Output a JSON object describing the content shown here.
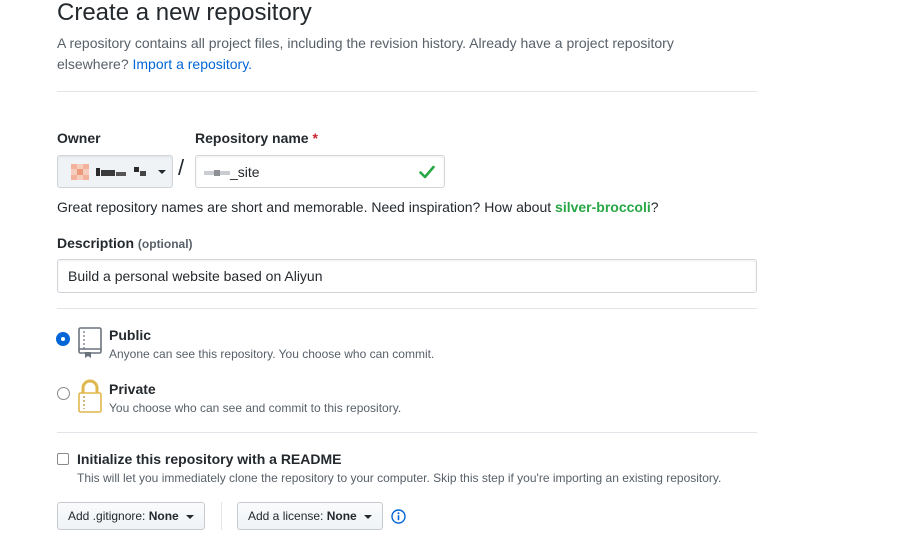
{
  "header": {
    "title": "Create a new repository",
    "subtitle": "A repository contains all project files, including the revision history. Already have a project repository elsewhere?",
    "import_link": "Import a repository."
  },
  "owner": {
    "label": "Owner"
  },
  "repo_name": {
    "label": "Repository name",
    "required_mark": "*",
    "separator": "/",
    "value": "_site",
    "valid": true
  },
  "hint": {
    "prefix": "Great repository names are short and memorable. Need inspiration? How about",
    "suggestion": "silver-broccoli",
    "suffix": "?"
  },
  "description": {
    "label": "Description",
    "optional": "(optional)",
    "value": "Build a personal website based on Aliyun"
  },
  "visibility": {
    "public": {
      "title": "Public",
      "desc": "Anyone can see this repository. You choose who can commit.",
      "selected": true
    },
    "private": {
      "title": "Private",
      "desc": "You choose who can see and commit to this repository.",
      "selected": false
    }
  },
  "readme": {
    "title": "Initialize this repository with a README",
    "desc": "This will let you immediately clone the repository to your computer. Skip this step if you're importing an existing repository.",
    "checked": false
  },
  "buttons": {
    "gitignore_prefix": "Add .gitignore:",
    "gitignore_value": "None",
    "license_prefix": "Add a license:",
    "license_value": "None"
  },
  "colors": {
    "link": "#0366d6",
    "success": "#28a745",
    "required": "#cb2431"
  }
}
